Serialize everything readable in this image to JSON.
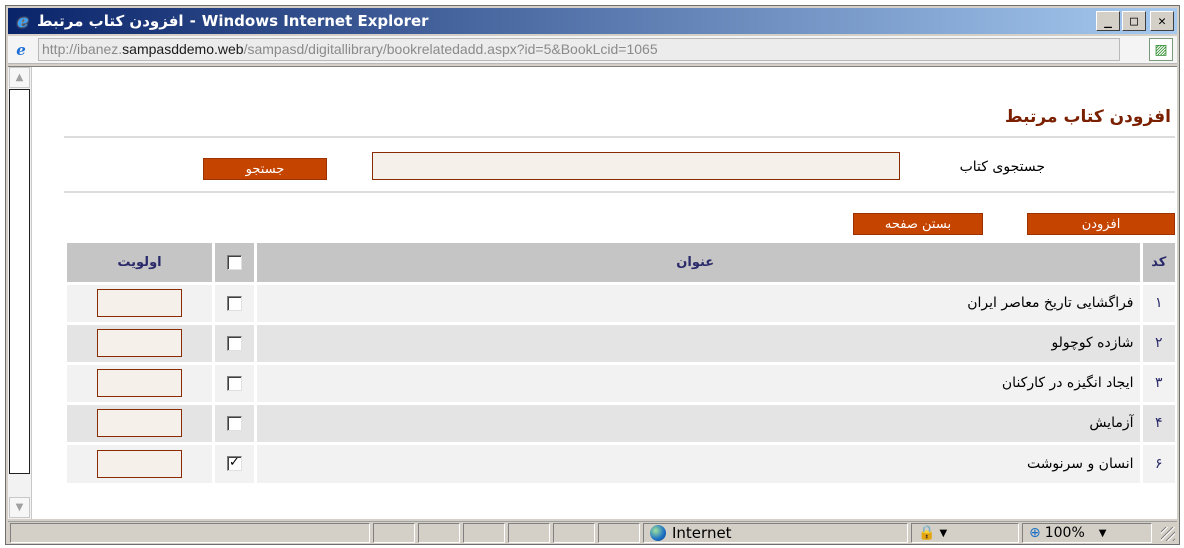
{
  "window": {
    "title_page": "افزودن کتاب مرتبط",
    "title_separator": "-",
    "title_app": "Windows Internet Explorer",
    "controls": {
      "minimize": "_",
      "maximize": "□",
      "close": "✕"
    }
  },
  "address_bar": {
    "url_prefix": "http://ibanez.",
    "url_host": "sampasddemo.web",
    "url_path": "/sampasd/digitallibrary/bookrelatedadd.aspx?id=5&BookLcid=1065"
  },
  "page": {
    "title": "افزودن کتاب مرتبط",
    "search": {
      "label": "جستجوی کتاب",
      "value": "",
      "button_label": "جستجو"
    },
    "actions": {
      "add_label": "افزودن",
      "close_label": "بستن صفحه"
    },
    "table": {
      "headers": {
        "code": "کد",
        "title": "عنوان",
        "priority": "اولویت"
      },
      "rows": [
        {
          "code": "۱",
          "title": "فراگشایی تاریخ معاصر ایران",
          "checked": false,
          "priority": ""
        },
        {
          "code": "۲",
          "title": "شازده کوچولو",
          "checked": false,
          "priority": ""
        },
        {
          "code": "۳",
          "title": "ایجاد انگیزه در کارکنان",
          "checked": false,
          "priority": ""
        },
        {
          "code": "۴",
          "title": "آزمایش",
          "checked": false,
          "priority": ""
        },
        {
          "code": "۶",
          "title": "انسان و سرنوشت",
          "checked": true,
          "priority": ""
        }
      ]
    }
  },
  "status_bar": {
    "zone": "Internet",
    "zoom": "100%"
  },
  "colors": {
    "accent": "#c44400",
    "title_text": "#7a1f00",
    "header_bg": "#c5c5c5"
  }
}
